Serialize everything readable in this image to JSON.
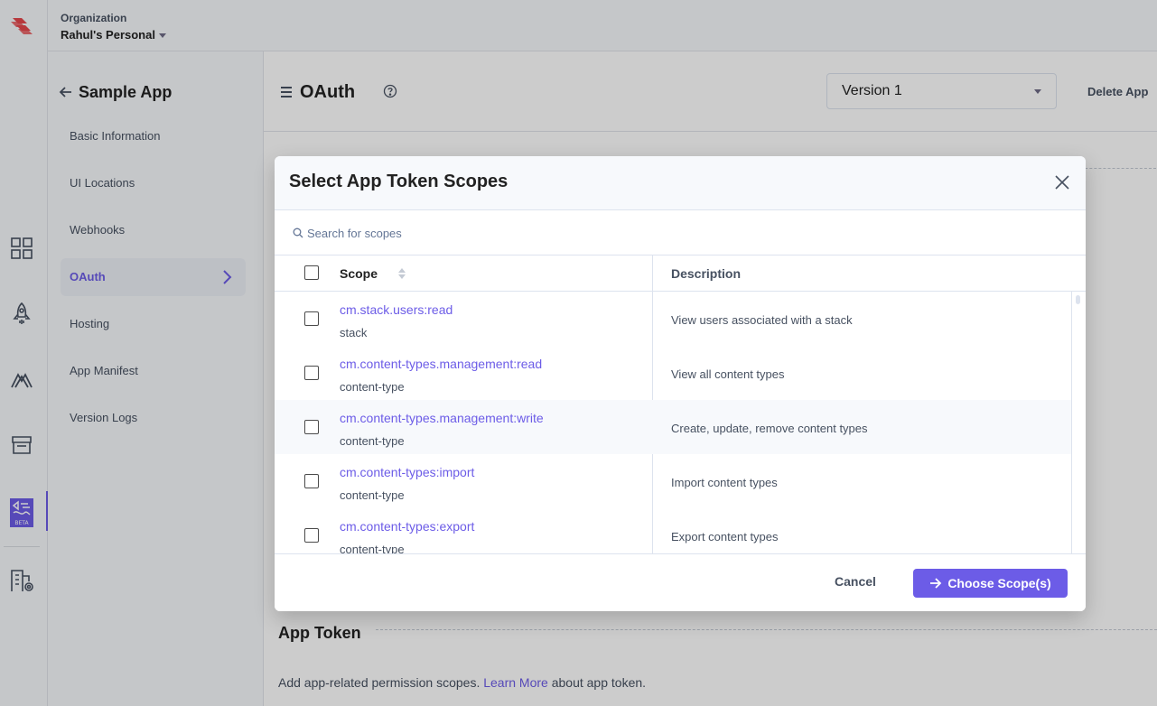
{
  "org": {
    "label": "Organization",
    "name": "Rahul's Personal"
  },
  "rail": {
    "icons": [
      "logo-icon",
      "dashboard-icon",
      "launch-icon",
      "automate-icon",
      "marketplace-icon",
      "developer-hub-icon",
      "org-settings-icon"
    ],
    "beta_badge": "BETA"
  },
  "sidebar": {
    "title": "Sample App",
    "items": [
      {
        "label": "Basic Information"
      },
      {
        "label": "UI Locations"
      },
      {
        "label": "Webhooks"
      },
      {
        "label": "OAuth",
        "active": true
      },
      {
        "label": "Hosting"
      },
      {
        "label": "App Manifest"
      },
      {
        "label": "Version Logs"
      }
    ]
  },
  "header": {
    "title": "OAuth",
    "version": "Version 1",
    "delete_label": "Delete App"
  },
  "app_token": {
    "title": "App Token",
    "desc_before": "Add app-related permission scopes.",
    "link": "Learn More",
    "desc_after": "about app token."
  },
  "modal": {
    "title": "Select App Token Scopes",
    "search_placeholder": "Search for scopes",
    "columns": {
      "scope": "Scope",
      "description": "Description"
    },
    "rows": [
      {
        "scope": "cm.stack.users:read",
        "type": "stack",
        "description": "View users associated with a stack"
      },
      {
        "scope": "cm.content-types.management:read",
        "type": "content-type",
        "description": "View all content types"
      },
      {
        "scope": "cm.content-types.management:write",
        "type": "content-type",
        "description": "Create, update, remove content types"
      },
      {
        "scope": "cm.content-types:import",
        "type": "content-type",
        "description": "Import content types"
      },
      {
        "scope": "cm.content-types:export",
        "type": "content-type",
        "description": "Export content types"
      }
    ],
    "cancel_label": "Cancel",
    "choose_label": "Choose Scope(s)"
  },
  "colors": {
    "accent": "#6c5ce7",
    "brand": "#e5474b",
    "text": "#222222",
    "muted": "#475161"
  }
}
